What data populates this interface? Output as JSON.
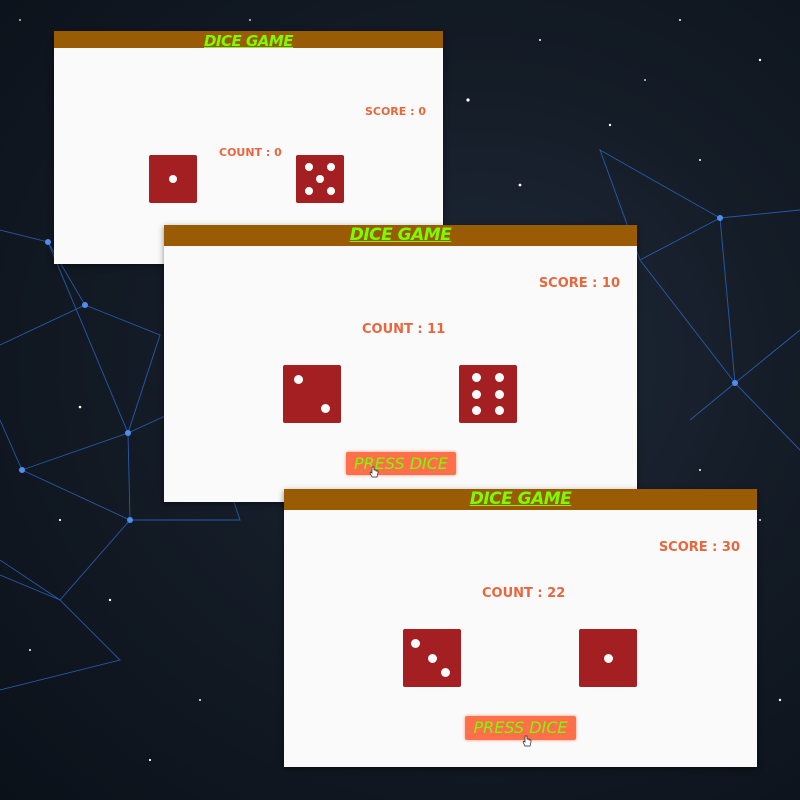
{
  "theme": {
    "titlebar_color": "#9a5b05",
    "title_color": "#7cfc00",
    "score_color": "#e8663e",
    "die_color": "#a31f22",
    "button_color": "#ff6f4a"
  },
  "windows": [
    {
      "title": "DICE GAME",
      "score_text": "SCORE : 0",
      "count_text": "COUNT : 0",
      "dice": [
        1,
        5
      ],
      "button_label": null
    },
    {
      "title": "DICE GAME",
      "score_text": "SCORE : 10",
      "count_text": "COUNT : 11",
      "dice": [
        2,
        6
      ],
      "button_label": "PRESS DICE"
    },
    {
      "title": "DICE GAME",
      "score_text": "SCORE : 30",
      "count_text": "COUNT : 22",
      "dice": [
        3,
        1
      ],
      "button_label": "PRESS DICE"
    }
  ],
  "icons": {
    "cursor": "hand-pointer-icon",
    "background": "network-constellation"
  }
}
